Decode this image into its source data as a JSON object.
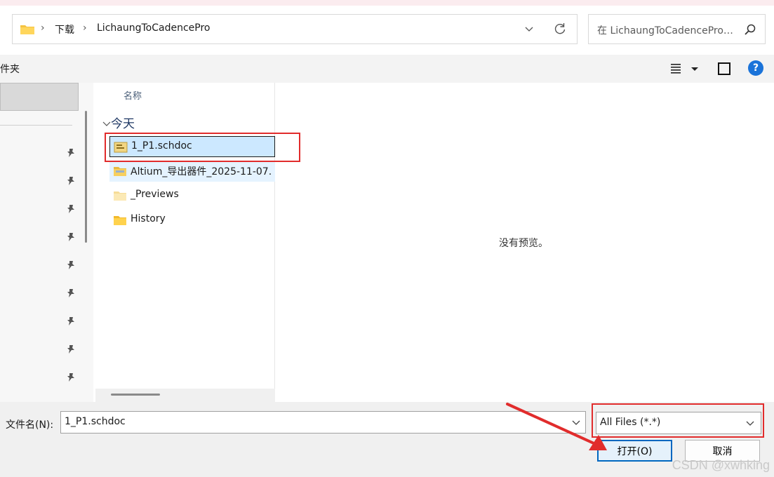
{
  "address_bar": {
    "crumbs": [
      "下载",
      "LichaungToCadencePro"
    ]
  },
  "search": {
    "text": "在 LichaungToCadencePro 中搜索"
  },
  "toolbar": {
    "new_folder_label": "件夹"
  },
  "file_list": {
    "column_header": "名称",
    "group_label": "今天",
    "items": [
      {
        "name": "1_P1.schdoc",
        "icon": "schdoc-file-icon",
        "state": "selected"
      },
      {
        "name": "Altium_导出器件_2025-11-07.",
        "icon": "zip-folder-icon",
        "state": "hover"
      },
      {
        "name": "_Previews",
        "icon": "folder-icon-light",
        "state": "normal"
      },
      {
        "name": "History",
        "icon": "folder-icon",
        "state": "normal"
      }
    ]
  },
  "preview": {
    "empty_text": "没有预览。"
  },
  "bottom": {
    "filename_label": "文件名(N):",
    "filename_value": "1_P1.schdoc",
    "filetype_value": "All Files (*.*)",
    "open_label": "打开(O)",
    "cancel_label": "取消"
  },
  "watermark": "CSDN @xwhking",
  "colors": {
    "accent": "#0067c0",
    "selection": "#cce8ff",
    "annotation": "#e12c2c",
    "help": "#1a73d9"
  }
}
